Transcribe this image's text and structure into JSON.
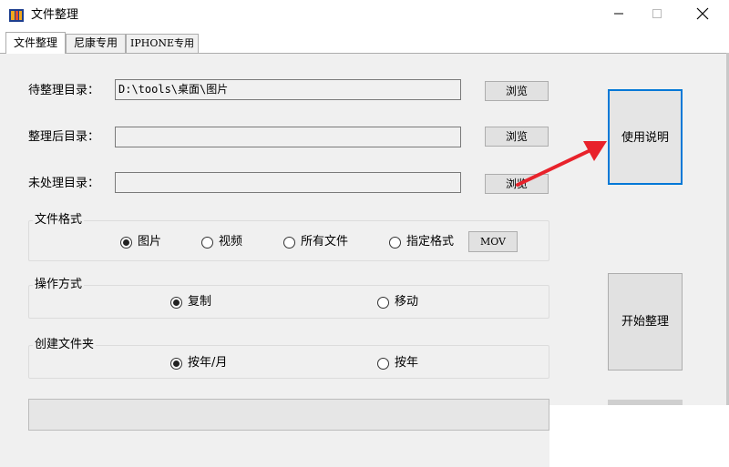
{
  "window": {
    "title": "文件整理",
    "icon": "folder-grid-icon"
  },
  "tabs": [
    {
      "label": "文件整理",
      "active": true
    },
    {
      "label": "尼康专用",
      "active": false
    },
    {
      "label": "IPHONE专用",
      "active": false
    }
  ],
  "directories": {
    "source": {
      "label": "待整理目录：",
      "value": "D:\\tools\\桌面\\图片",
      "browse": "浏览"
    },
    "target": {
      "label": "整理后目录：",
      "value": "",
      "browse": "浏览"
    },
    "unprocessed": {
      "label": "未处理目录：",
      "value": "",
      "browse": "浏览"
    }
  },
  "file_format": {
    "title": "文件格式",
    "options": [
      "图片",
      "视频",
      "所有文件",
      "指定格式"
    ],
    "selected": "图片",
    "custom_format": "MOV"
  },
  "operation": {
    "title": "操作方式",
    "options": [
      "复制",
      "移动"
    ],
    "selected": "复制"
  },
  "create_folder": {
    "title": "创建文件夹",
    "options": [
      "按年/月",
      "按年"
    ],
    "selected": "按年/月"
  },
  "actions": {
    "help": "使用说明",
    "start": "开始整理"
  },
  "colors": {
    "panel_bg": "#f0f0f0",
    "focus_border": "#0078d7",
    "arrow": "#e8222b"
  }
}
